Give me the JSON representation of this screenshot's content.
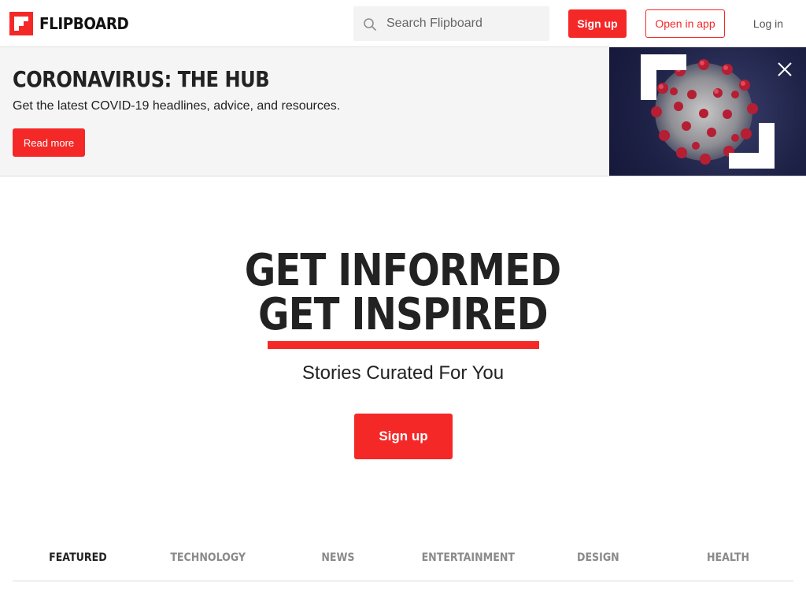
{
  "header": {
    "logo_text": "FLIPBOARD",
    "search_placeholder": "Search Flipboard",
    "signup_label": "Sign up",
    "open_app_label": "Open in app",
    "login_label": "Log in"
  },
  "banner": {
    "title": "CORONAVIRUS: THE HUB",
    "subtitle": "Get the latest COVID-19 headlines, advice, and resources.",
    "read_more_label": "Read more"
  },
  "hero": {
    "line1": "GET INFORMED",
    "line2": "GET INSPIRED",
    "tagline": "Stories Curated For You",
    "signup_label": "Sign up"
  },
  "tabs": [
    {
      "label": "FEATURED",
      "active": true
    },
    {
      "label": "TECHNOLOGY",
      "active": false
    },
    {
      "label": "NEWS",
      "active": false
    },
    {
      "label": "ENTERTAINMENT",
      "active": false
    },
    {
      "label": "DESIGN",
      "active": false
    },
    {
      "label": "HEALTH",
      "active": false
    }
  ],
  "colors": {
    "brand_red": "#f52828",
    "text_dark": "#222222",
    "banner_bg": "#f5f5f5"
  },
  "icons": {
    "logo": "flipboard-logo-icon",
    "search": "search-icon",
    "close": "close-icon"
  }
}
